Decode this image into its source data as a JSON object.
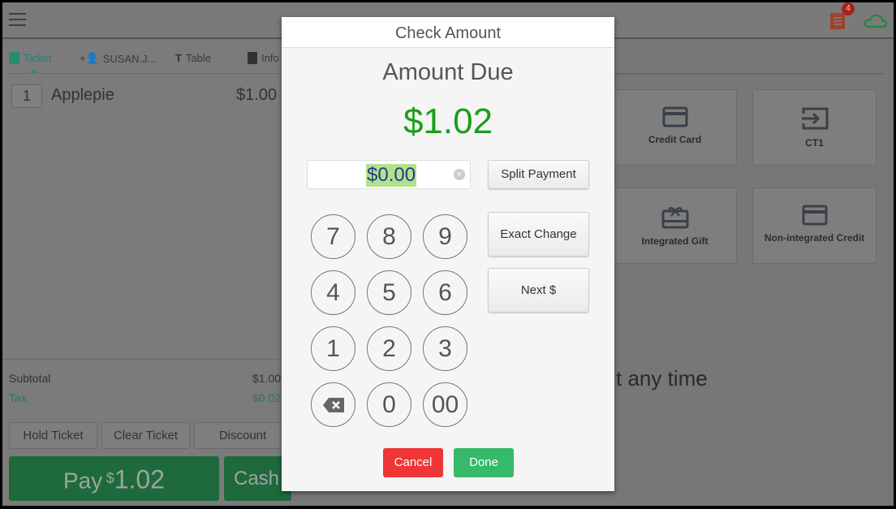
{
  "header": {
    "notification_count": "4"
  },
  "tabs": [
    {
      "label": "Ticket"
    },
    {
      "label": "SUSAN.J..."
    },
    {
      "label": "Table"
    },
    {
      "label": "Info"
    }
  ],
  "ticket": {
    "items": [
      {
        "qty": "1",
        "name": "Applepie",
        "price": "$1.00"
      }
    ],
    "subtotal_label": "Subtotal",
    "subtotal": "$1.00",
    "tax_label": "Tax",
    "tax": "$0.02"
  },
  "actions": {
    "hold": "Hold Ticket",
    "clear": "Clear Ticket",
    "discount": "Discount",
    "pay_label": "Pay",
    "pay_currency": "$",
    "pay_amount": "1.02",
    "cash": "Cash"
  },
  "payment_tiles": [
    {
      "label": "Credit Card",
      "icon": "credit-card-icon"
    },
    {
      "label": "CT1",
      "icon": "enter-arrow-icon"
    },
    {
      "label": "Integrated Gift",
      "icon": "gift-card-icon"
    },
    {
      "label": "Non-integrated Credit",
      "icon": "credit-card-icon"
    }
  ],
  "background_text": "t any time",
  "modal": {
    "title": "Check Amount",
    "amount_due_label": "Amount Due",
    "amount_due": "$1.02",
    "input_value": "$0.00",
    "keys": [
      "7",
      "8",
      "9",
      "4",
      "5",
      "6",
      "1",
      "2",
      "3",
      "⌫",
      "0",
      "00"
    ],
    "split": "Split Payment",
    "exact": "Exact Change",
    "next": "Next $",
    "cancel": "Cancel",
    "done": "Done"
  },
  "colors": {
    "accent_green": "#1a9e1a",
    "teal": "#2a8a80",
    "cancel": "#ef3535",
    "done": "#37b96a",
    "selection": "#b4e08c"
  }
}
